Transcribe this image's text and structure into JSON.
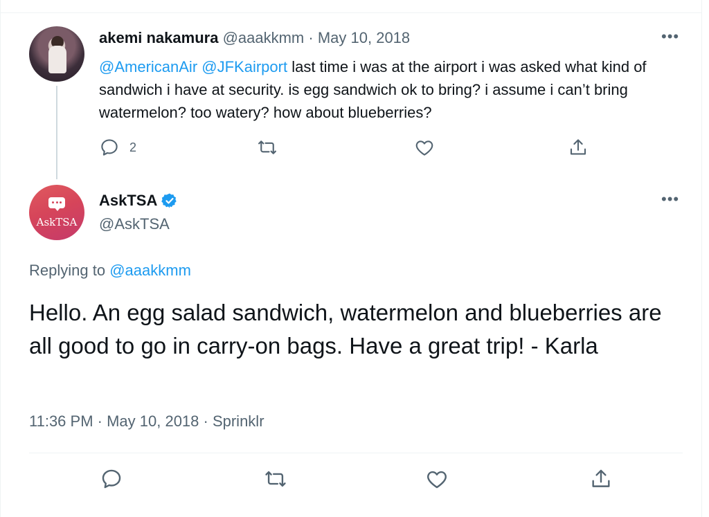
{
  "parent_tweet": {
    "author_name": "akemi nakamura",
    "author_handle": "@aaakkmm",
    "separator": "·",
    "date": "May 10, 2018",
    "more_label": "•••",
    "mention_1": "@AmericanAir",
    "mention_2": "@JFKairport",
    "body": "last time i was at the airport i was asked what kind of sandwich i have at security. is egg sandwich ok to bring? i assume i can’t bring watermelon? too watery? how about blueberries?",
    "reply_count": "2",
    "icons": [
      "reply-icon",
      "retweet-icon",
      "like-icon",
      "share-icon"
    ]
  },
  "main_tweet": {
    "author_name": "AskTSA",
    "author_handle": "@AskTSA",
    "avatar_text": "AskTSA",
    "more_label": "•••",
    "replying_prefix": "Replying to",
    "replying_handle": "@aaakkmm",
    "body": "Hello. An egg salad sandwich, watermelon and blueberries are all good to go in carry-on bags. Have a great trip! - Karla",
    "timestamp": "11:36 PM · May 10, 2018 · Sprinklr",
    "icons": [
      "reply-icon",
      "retweet-icon",
      "like-icon",
      "share-icon"
    ]
  },
  "colors": {
    "accent": "#1d9bf0",
    "text": "#0f1419",
    "secondary_text": "#536471",
    "border": "#eff3f4",
    "asktsa_brand": "#d6455a"
  }
}
